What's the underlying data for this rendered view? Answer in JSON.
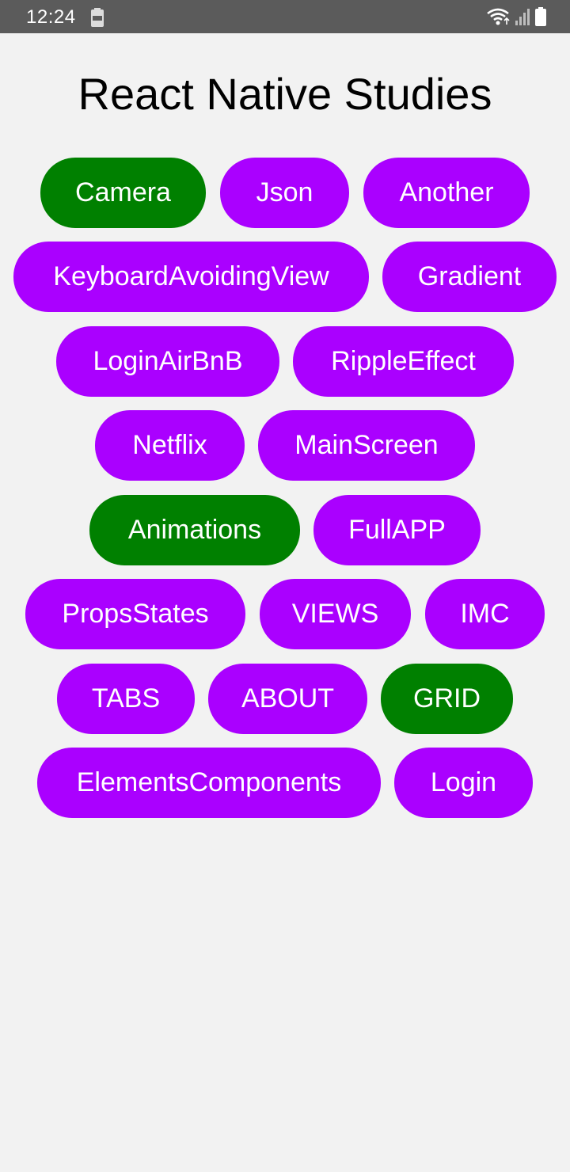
{
  "status_bar": {
    "time": "12:24",
    "left_icon": "battery-saver-icon",
    "right_icons": [
      "wifi-icon",
      "signal-icon",
      "battery-icon"
    ]
  },
  "title": "React Native Studies",
  "colors": {
    "purple": "#aa00ff",
    "green": "#008000",
    "background": "#f2f2f2",
    "status_bar": "#5b5b5b"
  },
  "buttons": {
    "camera": "Camera",
    "json": "Json",
    "another": "Another",
    "keyboard_avoiding_view": "KeyboardAvoidingView",
    "gradient": "Gradient",
    "login_airbnb": "LoginAirBnB",
    "ripple_effect": "RippleEffect",
    "netflix": "Netflix",
    "main_screen": "MainScreen",
    "animations": "Animations",
    "full_app": "FullAPP",
    "props_states": "PropsStates",
    "views": "VIEWS",
    "imc": "IMC",
    "tabs": "TABS",
    "about": "ABOUT",
    "grid": "GRID",
    "elements_components": "ElementsComponents",
    "login": "Login"
  }
}
